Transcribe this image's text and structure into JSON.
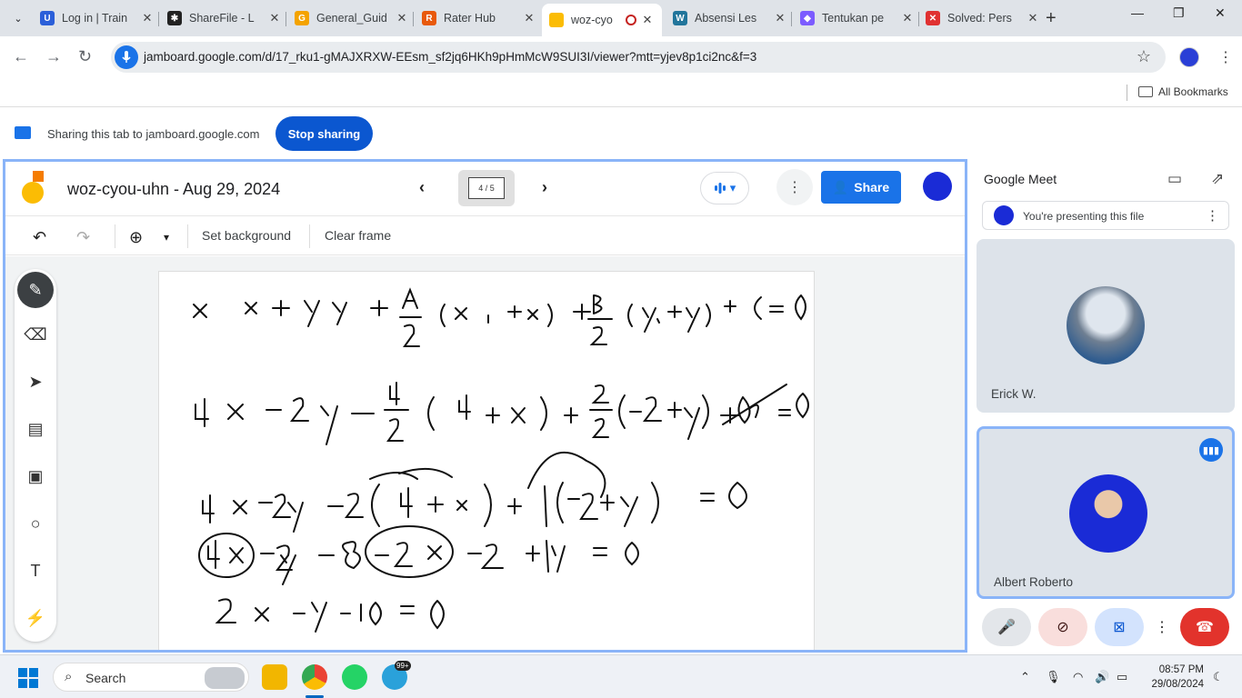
{
  "browser": {
    "tabs": [
      {
        "title": "Log in | Train",
        "favicon_color": "#2b5fd9"
      },
      {
        "title": "ShareFile - L",
        "favicon_color": "#222222"
      },
      {
        "title": "General_Guid",
        "favicon_color": "#f4a300"
      },
      {
        "title": "Rater Hub",
        "favicon_color": "#e8590c"
      },
      {
        "title": "woz-cyo",
        "favicon_color": "#fbbc04",
        "active": true
      },
      {
        "title": "Absensi Les",
        "favicon_color": "#21759b"
      },
      {
        "title": "Tentukan pe",
        "favicon_color": "#7c5cff"
      },
      {
        "title": "Solved: Pers",
        "favicon_color": "#e03131"
      }
    ],
    "url": "jamboard.google.com/d/17_rku1-gMAJXRXW-EEsm_sf2jq6HKh9pHmMcW9SUI3I/viewer?mtt=yjev8p1ci2nc&f=3",
    "bookmarks_label": "All Bookmarks"
  },
  "sharing": {
    "text": "Sharing this tab to jamboard.google.com",
    "stop_label": "Stop sharing"
  },
  "jamboard": {
    "title": "woz-cyou-uhn - Aug 29, 2024",
    "frame_indicator": "4 / 5",
    "share_label": "Share",
    "set_background": "Set background",
    "clear_frame": "Clear frame",
    "handwriting": [
      "x₁x + y₁y + A/2 (x₁ + x) + B/2 (y₁ + y) + C = 0",
      "4x − 2y − 4/2 (4 + x) + 2/2 (−2 + y) + 10 = 0",
      "4x − 2y − 2(4 + x) + 1(−2 + y) = 0",
      "4x − 2y − 8 − 2x − 2 + y = 0",
      "2x − y − 10 = 0"
    ]
  },
  "meet": {
    "title": "Google Meet",
    "presenting_text": "You're presenting this file",
    "participants": [
      {
        "name": "Erick W."
      },
      {
        "name": "Albert Roberto"
      }
    ]
  },
  "taskbar": {
    "search_placeholder": "Search",
    "telegram_badge": "99+",
    "time": "08:57 PM",
    "date": "29/08/2024"
  }
}
